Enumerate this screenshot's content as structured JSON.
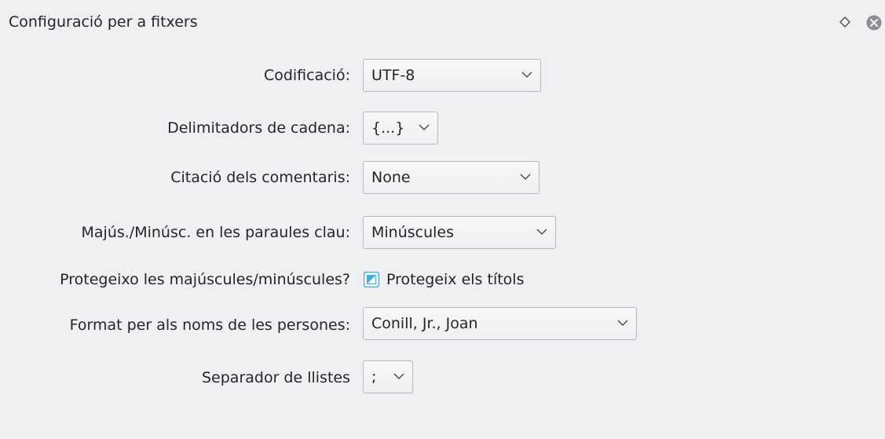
{
  "window": {
    "title": "Configuració per a fitxers"
  },
  "icons": {
    "float": "diamond-float-icon",
    "close": "close-circle-icon",
    "dropdown": "chevron-down-icon"
  },
  "colors": {
    "background": "#eff0f1",
    "text": "#232629",
    "accent": "#3daee9",
    "border": "#b5b9bd"
  },
  "form": {
    "encoding": {
      "label": "Codificació:",
      "value": "UTF-8"
    },
    "string_delimiters": {
      "label": "Delimitadors de cadena:",
      "value": "{...}"
    },
    "comment_quoting": {
      "label": "Citació dels comentaris:",
      "value": "None"
    },
    "keyword_casing": {
      "label": "Majús./Minúsc. en les paraules clau:",
      "value": "Minúscules"
    },
    "protect_casing": {
      "label": "Protegeixo les majúscules/minúscules?",
      "checkbox_label": "Protegeix els títols",
      "checked": true
    },
    "person_name_format": {
      "label": "Format per als noms de les persones:",
      "value": "Conill, Jr., Joan"
    },
    "list_separator": {
      "label": "Separador de llistes",
      "value": ";"
    }
  }
}
